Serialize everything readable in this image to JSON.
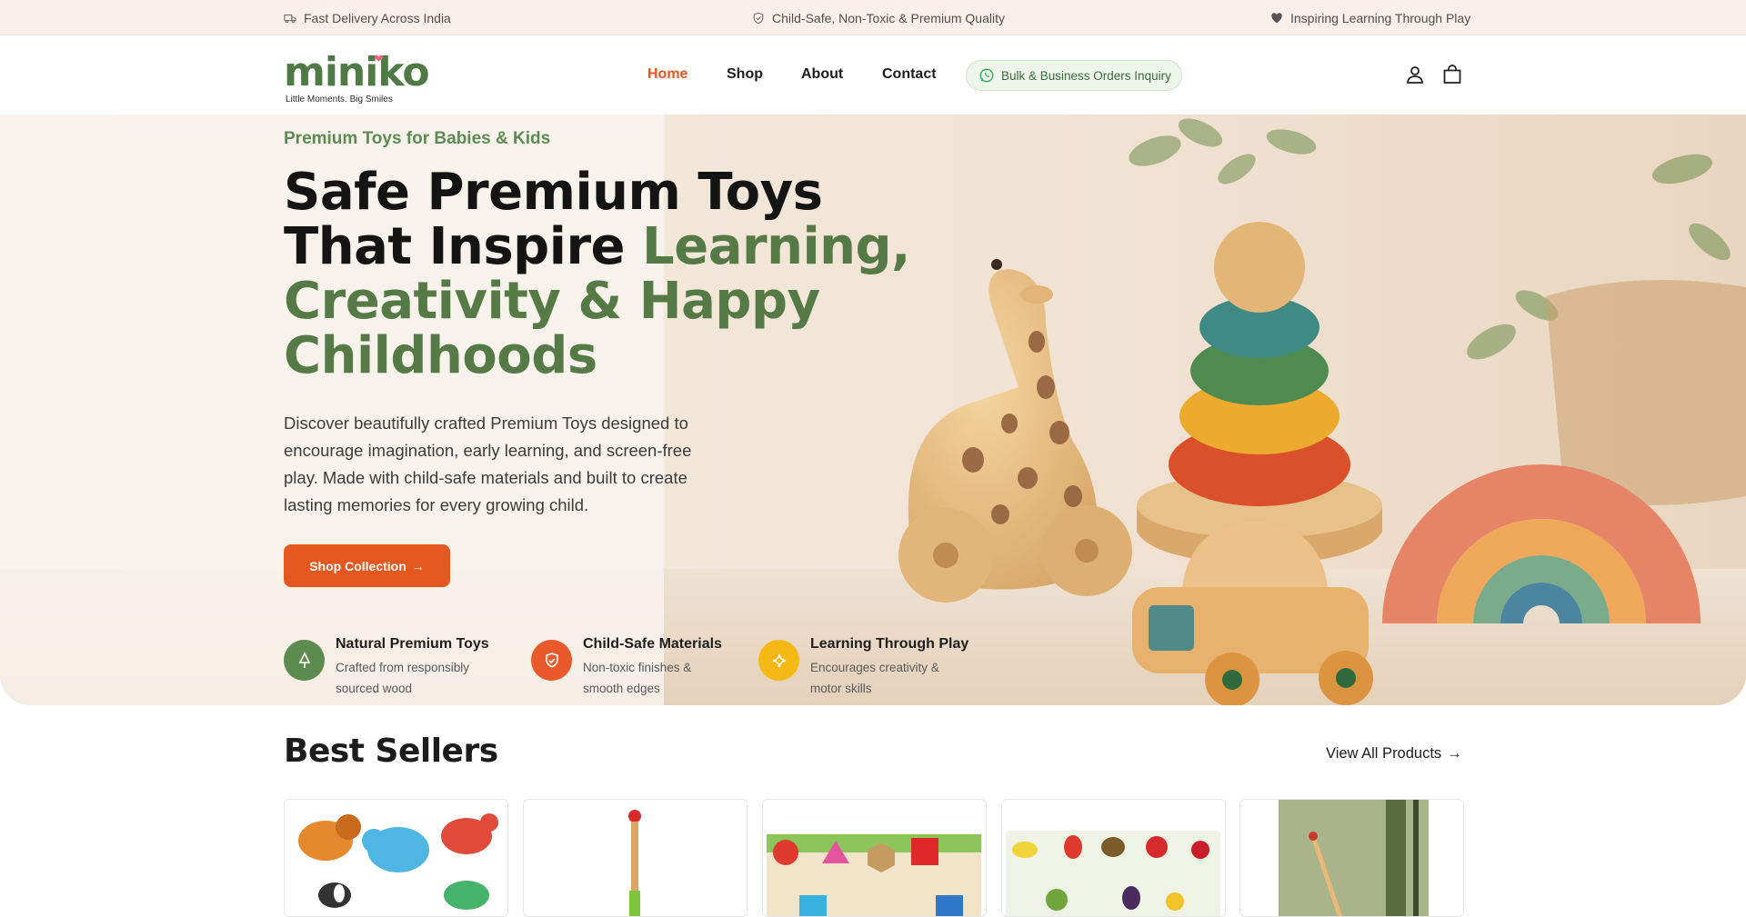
{
  "announcement": {
    "items": [
      {
        "icon": "truck-icon",
        "text": "Fast Delivery Across India"
      },
      {
        "icon": "shield-icon",
        "text": "Child-Safe, Non-Toxic & Premium Quality"
      },
      {
        "icon": "heart-icon",
        "text": "Inspiring Learning Through Play"
      }
    ]
  },
  "header": {
    "logo_text": "miniko",
    "logo_tagline": "Little Moments. Big Smiles",
    "nav": [
      "Home",
      "Shop",
      "About",
      "Contact"
    ],
    "active_nav": "Home",
    "bulk_button": "Bulk & Business Orders Inquiry",
    "icons": [
      "user-icon",
      "shopping-bag-icon"
    ]
  },
  "hero": {
    "eyebrow": "Premium Toys for Babies & Kids",
    "headline_dark": "Safe Premium Toys That Inspire",
    "headline_green": "Learning, Creativity & Happy Childhoods",
    "description": "Discover beautifully crafted Premium Toys designed to encourage imagination, early learning, and screen-free play. Made with child-safe materials and built to create lasting memories for every growing child.",
    "cta": "Shop Collection",
    "features": [
      {
        "icon": "tree-icon",
        "title": "Natural Premium Toys",
        "text": "Crafted from responsibly sourced wood",
        "color": "#5d8a4e"
      },
      {
        "icon": "shield-check-icon",
        "title": "Child-Safe Materials",
        "text": "Non-toxic finishes & smooth edges",
        "color": "#e9592b"
      },
      {
        "icon": "sparkle-icon",
        "title": "Learning Through Play",
        "text": "Encourages creativity & motor skills",
        "color": "#f4b914"
      }
    ]
  },
  "best_sellers": {
    "title": "Best Sellers",
    "view_all": "View All Products",
    "products": [
      {
        "name": "wooden-animal-puzzle-image"
      },
      {
        "name": "wooden-stick-toy-image"
      },
      {
        "name": "shape-puzzle-board-image"
      },
      {
        "name": "fruit-puzzle-board-image"
      },
      {
        "name": "wooden-toy-lifestyle-image"
      }
    ]
  },
  "colors": {
    "accent": "#e4581f",
    "brand_green": "#557a45",
    "topbar_bg": "#fbefe9"
  }
}
